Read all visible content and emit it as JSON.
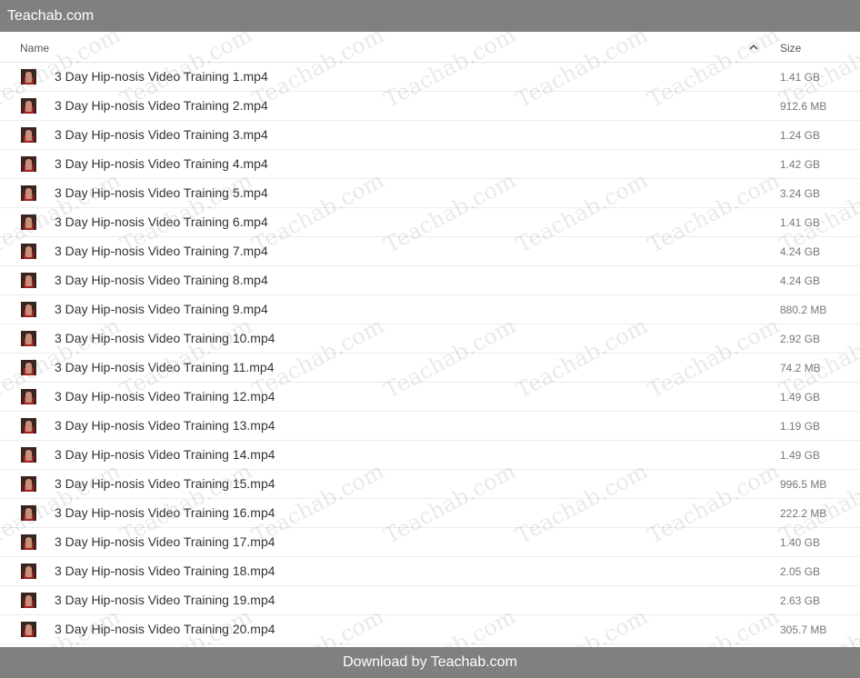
{
  "window": {
    "title": "Teachab.com"
  },
  "header": {
    "name_label": "Name",
    "size_label": "Size",
    "sort_icon": "chevron-up-icon"
  },
  "files": [
    {
      "name": "3 Day Hip-nosis Video Training 1.mp4",
      "size": "1.41 GB"
    },
    {
      "name": "3 Day Hip-nosis Video Training 2.mp4",
      "size": "912.6 MB"
    },
    {
      "name": "3 Day Hip-nosis Video Training 3.mp4",
      "size": "1.24 GB"
    },
    {
      "name": "3 Day Hip-nosis Video Training 4.mp4",
      "size": "1.42 GB"
    },
    {
      "name": "3 Day Hip-nosis Video Training 5.mp4",
      "size": "3.24 GB"
    },
    {
      "name": "3 Day Hip-nosis Video Training 6.mp4",
      "size": "1.41 GB"
    },
    {
      "name": "3 Day Hip-nosis Video Training 7.mp4",
      "size": "4.24 GB"
    },
    {
      "name": "3 Day Hip-nosis Video Training 8.mp4",
      "size": "4.24 GB"
    },
    {
      "name": "3 Day Hip-nosis Video Training 9.mp4",
      "size": "880.2 MB"
    },
    {
      "name": "3 Day Hip-nosis Video Training 10.mp4",
      "size": "2.92 GB"
    },
    {
      "name": "3 Day Hip-nosis Video Training 11.mp4",
      "size": "74.2 MB"
    },
    {
      "name": "3 Day Hip-nosis Video Training 12.mp4",
      "size": "1.49 GB"
    },
    {
      "name": "3 Day Hip-nosis Video Training 13.mp4",
      "size": "1.19 GB"
    },
    {
      "name": "3 Day Hip-nosis Video Training 14.mp4",
      "size": "1.49 GB"
    },
    {
      "name": "3 Day Hip-nosis Video Training 15.mp4",
      "size": "996.5 MB"
    },
    {
      "name": "3 Day Hip-nosis Video Training 16.mp4",
      "size": "222.2 MB"
    },
    {
      "name": "3 Day Hip-nosis Video Training 17.mp4",
      "size": "1.40 GB"
    },
    {
      "name": "3 Day Hip-nosis Video Training 18.mp4",
      "size": "2.05 GB"
    },
    {
      "name": "3 Day Hip-nosis Video Training 19.mp4",
      "size": "2.63 GB"
    },
    {
      "name": "3 Day Hip-nosis Video Training 20.mp4",
      "size": "305.7 MB"
    }
  ],
  "footer": {
    "text": "Download by Teachab.com"
  },
  "watermark": {
    "text": "Teachab.com"
  },
  "colors": {
    "bar_background": "#808080",
    "bar_text": "#ffffff"
  }
}
